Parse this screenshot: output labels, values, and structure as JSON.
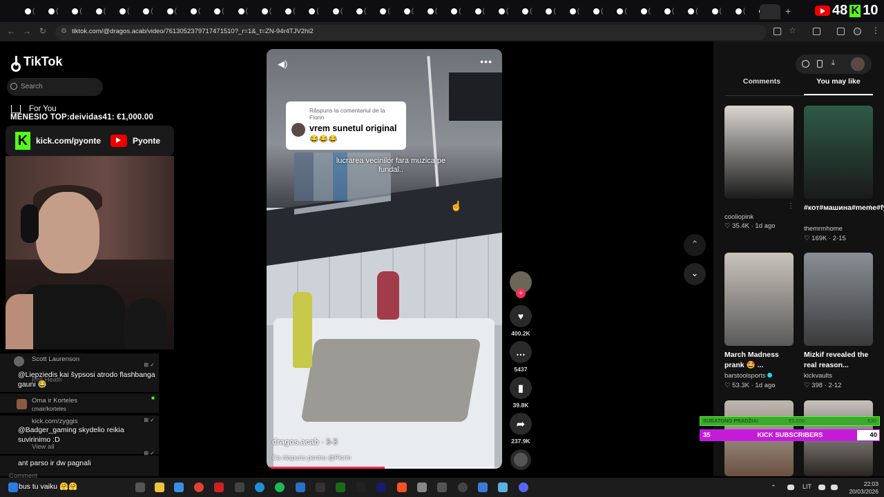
{
  "browser": {
    "tab_glyph": "(",
    "url": "tiktok.com/@dragos.acab/video/7613052379717471510?_r=1&_t=ZN-94r4TJV2hi2",
    "overlay_score_left": "48",
    "overlay_score_right": "10"
  },
  "tiktok": {
    "logo": "TikTok",
    "search_placeholder": "Search",
    "for_you": "For You"
  },
  "stream": {
    "top_donor": "MĖNESIO TOP:deividas41: €1,000.00",
    "kick_link": "kick.com/pyonte",
    "yt_name": "Pyonte"
  },
  "chat": [
    {
      "user": "Scott Laurenson",
      "text": "@Liepziedis kai šypsosi atrodo flashbanga gauni 😂",
      "sub": "Phil Heath"
    },
    {
      "user": "Oma ir Korteles",
      "text": "cmair/korteles"
    },
    {
      "user": "kick.com/zyggis",
      "text": "@Badger_gaming skydelio reikia suvirinimo :D",
      "sub": "View all"
    },
    {
      "user": "",
      "text": "ant parso ir dw pagnali"
    },
    {
      "user": "Comment",
      "text": "bus tu vaiku 🤗🤗"
    }
  ],
  "video": {
    "reply_header": "Răspuns la comentariul de la Florin",
    "reply_text": "vrem sunetul original",
    "reply_emoji": "😂😂😂",
    "caption": "lucrarea vecinilor fara muzica pe fundal..",
    "author": "dragos.acab",
    "date": " · 3-3",
    "description": "Ca răspuns pentru @Florin",
    "progress": 0.5
  },
  "actions": {
    "likes": "400.2K",
    "comments": "5437",
    "saves": "39.8K",
    "shares": "237.9K"
  },
  "panel": {
    "tab_comments": "Comments",
    "tab_like": "You may like",
    "cards": [
      {
        "title": "",
        "author": "cooliopink",
        "stats": "♡ 35.4K · 1d ago",
        "colors": [
          "#d9d6d2",
          "#1b1b1b"
        ]
      },
      {
        "title": "#кот#машина#meme#fyp#themrm...",
        "author": "themrmhome",
        "stats": "♡ 169K · 2-15",
        "colors": [
          "#2e5a48",
          "#1a1a1a"
        ]
      },
      {
        "title": "March Madness prank 🤩 ...",
        "author": "barstoolsports",
        "stats": "♡ 53.3K · 1d ago",
        "colors": [
          "#c9c4bc",
          "#5a5a5a"
        ]
      },
      {
        "title": "Mizkif revealed the real reason...",
        "author": "kickvaults",
        "stats": "♡ 398 · 2-12",
        "colors": [
          "#8a8f96",
          "#3a3a3a"
        ]
      }
    ]
  },
  "subs": {
    "top_label": "SUBATONO PRADŽIA!",
    "top_mid": "€5,000",
    "top_right": "€30",
    "current": "35",
    "label": "KICK SUBSCRIBERS",
    "goal": "40",
    "fraction": 0.875
  },
  "taskbar": {
    "chat_line": "bus tu vaiku 🤗🤗",
    "lang": "LIT",
    "time": "22:03",
    "date": "20/03/2026"
  },
  "colors": {
    "kick_green": "#53fc18",
    "tiktok_red": "#fe2c55",
    "sub_purple": "#c61ad9"
  }
}
